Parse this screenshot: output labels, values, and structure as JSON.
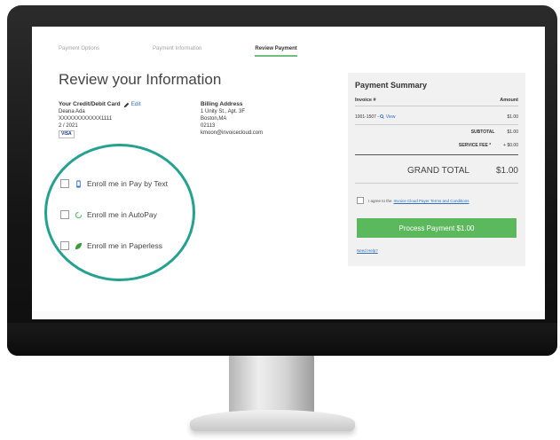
{
  "steps": {
    "payment_options": "Payment Options",
    "payment_information": "Payment Information",
    "review_payment": "Review Payment"
  },
  "page_title": "Review your Information",
  "card": {
    "heading": "Your Credit/Debit Card",
    "edit": "Edit",
    "name": "Deana Ada",
    "number": "XXXXXXXXXXXX1111",
    "expiry": "2 / 2021",
    "brand": "VISA"
  },
  "billing": {
    "heading": "Billing Address",
    "line1": "1 Unity St., Apt. 3F",
    "line2": "Boston,MA",
    "line3": "02113",
    "email": "kmoon@invoicecloud.com"
  },
  "enroll": {
    "pay_by_text": "Enroll me in Pay by Text",
    "autopay": "Enroll me in AutoPay",
    "paperless": "Enroll me in Paperless"
  },
  "summary": {
    "title": "Payment Summary",
    "col_invoice": "Invoice #",
    "col_amount": "Amount",
    "invoice_number": "1001-1507 -",
    "view": "View",
    "invoice_amount": "$1.00",
    "subtotal_label": "SUBTOTAL",
    "subtotal_value": "$1.00",
    "fee_label": "SERVICE FEE *",
    "fee_value": "+ $0.00",
    "grand_label": "GRAND TOTAL",
    "grand_value": "$1.00",
    "agree_text": "I agree to the",
    "terms_link": "Invoice Cloud Payer Terms and Conditions",
    "pay_button": "Process Payment $1.00",
    "need_help": "Need Help?"
  },
  "colors": {
    "accent_green": "#5cb85c",
    "ring_teal": "#24a18f",
    "link_blue": "#2e6fbf"
  }
}
